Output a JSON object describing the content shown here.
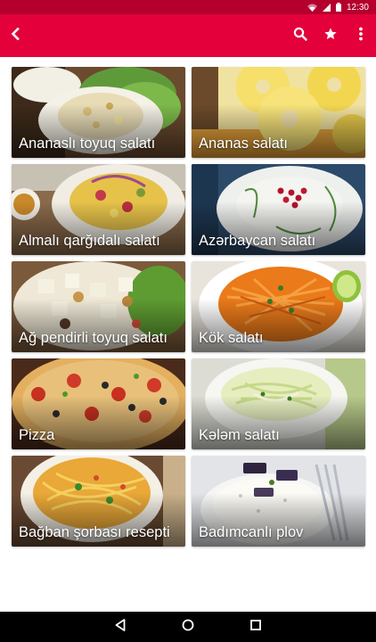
{
  "status_bar": {
    "time": "12:30",
    "icons": [
      "wifi-icon",
      "signal-icon",
      "battery-icon"
    ]
  },
  "app_bar": {
    "color": "#e4003a",
    "back_icon": "arrow-back-icon",
    "actions": [
      "search-icon",
      "star-icon",
      "more-vert-icon"
    ]
  },
  "recipes": [
    {
      "title": "Ananaslı toyuq salatı"
    },
    {
      "title": "Ananas salatı"
    },
    {
      "title": "Almalı qarğıdalı salatı"
    },
    {
      "title": "Azərbaycan salatı"
    },
    {
      "title": "Ağ pendirli toyuq salatı"
    },
    {
      "title": "Kök salatı"
    },
    {
      "title": "Pizza"
    },
    {
      "title": "Kələm salatı"
    },
    {
      "title": "Bağban şorbası resepti"
    },
    {
      "title": "Badımcanlı plov"
    }
  ],
  "nav_bar": {
    "buttons": [
      "back-triangle-icon",
      "home-circle-icon",
      "recents-square-icon"
    ]
  }
}
